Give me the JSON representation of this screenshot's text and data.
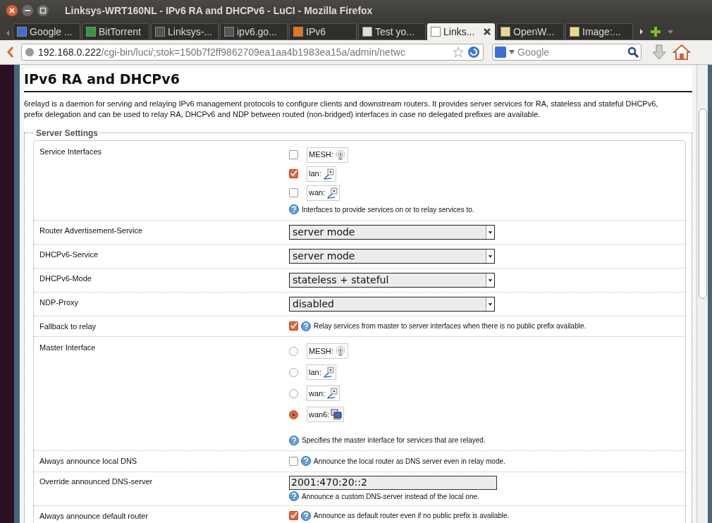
{
  "window": {
    "title": "Linksys-WRT160NL - IPv6 RA and DHCPv6 - LuCI - Mozilla Firefox"
  },
  "tabs": [
    {
      "label": "Google ...",
      "selected": false
    },
    {
      "label": "BitTorrent",
      "selected": false
    },
    {
      "label": "Linksys-...",
      "selected": false
    },
    {
      "label": "ipv6.go...",
      "selected": false
    },
    {
      "label": "IPv6",
      "selected": false
    },
    {
      "label": "Test yo...",
      "selected": false
    },
    {
      "label": "Links...",
      "selected": true
    },
    {
      "label": "OpenW...",
      "selected": false
    },
    {
      "label": "Image:...",
      "selected": false
    }
  ],
  "address": {
    "host": "192.168.0.222",
    "path": "/cgi-bin/luci/;stok=150b7f2ff9862709ea1aa4b1983ea15a/admin/netwc"
  },
  "search": {
    "placeholder": "Google"
  },
  "page": {
    "heading": "IPv6 RA and DHCPv6",
    "description": "6relayd is a daemon for serving and relaying IPv6 management protocols to configure clients and downstream routers. It provides server services for RA, stateless and stateful DHCPv6, prefix delegation and can be used to relay RA, DHCPv6 and NDP between routed (non-bridged) interfaces in case no delegated prefixes are available.",
    "legend": "Server Settings",
    "rows": [
      {
        "kind": "checklist",
        "label": "Service Interfaces",
        "options": [
          {
            "name": "MESH:",
            "kind": "wireless",
            "checked": false
          },
          {
            "name": "lan:",
            "kind": "ethernet",
            "checked": true
          },
          {
            "name": "wan:",
            "kind": "ethernet",
            "checked": false
          }
        ],
        "help": "Interfaces to provide services on or to relay services to."
      },
      {
        "kind": "select",
        "label": "Router Advertisement-Service",
        "value": "server mode"
      },
      {
        "kind": "select",
        "label": "DHCPv6-Service",
        "value": "server mode"
      },
      {
        "kind": "select",
        "label": "DHCPv6-Mode",
        "value": "stateless + stateful"
      },
      {
        "kind": "select",
        "label": "NDP-Proxy",
        "value": "disabled"
      },
      {
        "kind": "checkbox",
        "label": "Fallback to relay",
        "checked": true,
        "help": "Relay services from master to server interfaces when there is no public prefix available."
      },
      {
        "kind": "radiolist",
        "label": "Master Interface",
        "options": [
          {
            "name": "MESH:",
            "kind": "wireless",
            "selected": false
          },
          {
            "name": "lan:",
            "kind": "ethernet",
            "selected": false
          },
          {
            "name": "wan:",
            "kind": "ethernet",
            "selected": false
          },
          {
            "name": "wan6:",
            "kind": "tunnel",
            "selected": true
          }
        ],
        "help": "Specifies the master interface for services that are relayed."
      },
      {
        "kind": "checkbox",
        "label": "Always announce local DNS",
        "checked": false,
        "help": "Announce the local router as DNS server even in relay mode."
      },
      {
        "kind": "text",
        "label": "Override announced DNS-server",
        "value": "2001:470:20::2",
        "help": "Announce a custom DNS-server instead of the local one."
      },
      {
        "kind": "checkbox",
        "label": "Always announce default router",
        "checked": true,
        "help": "Announce as default router even if no public prefix is available."
      }
    ]
  }
}
